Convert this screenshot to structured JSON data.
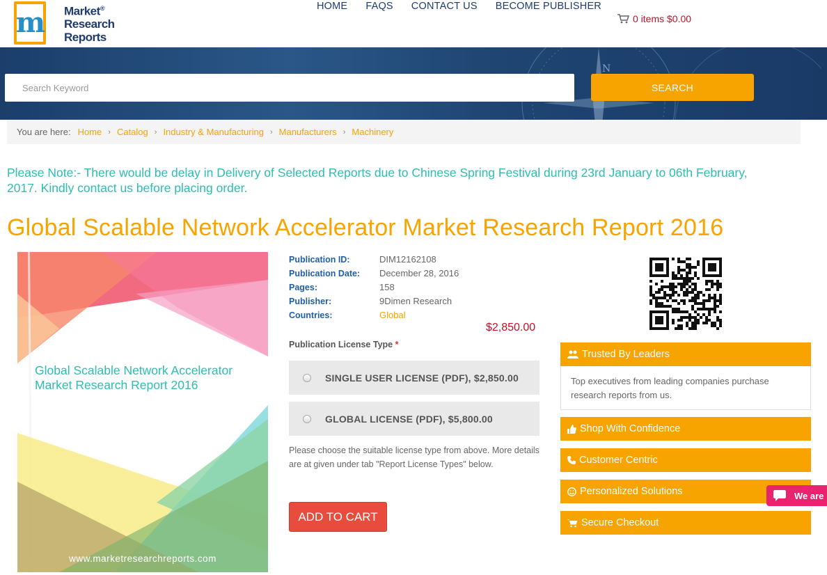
{
  "logo": {
    "line1": "Market",
    "line2": "Research",
    "line3": "Reports",
    "mark": "m",
    "reg": "®"
  },
  "nav": [
    "HOME",
    "FAQS",
    "CONTACT US",
    "BECOME PUBLISHER"
  ],
  "cart": {
    "label": "0 items $0.00",
    "icon": "cart-icon"
  },
  "search": {
    "placeholder": "Search Keyword",
    "button": "SEARCH"
  },
  "breadcrumb": {
    "lead": "You are here:",
    "items": [
      "Home",
      "Catalog",
      "Industry & Manufacturing",
      "Manufacturers",
      "Machinery"
    ]
  },
  "note": "Please Note:- There would be delay in Delivery of Selected Reports due to Chinese Spring Festival during 23rd January to 06th February, 2017. Kindly contact us before placing order.",
  "title": "Global Scalable Network Accelerator Market Research Report 2016",
  "cover": {
    "title": "Global Scalable Network Accelerator Market Research Report 2016",
    "url": "www.marketresearchreports.com"
  },
  "details": [
    {
      "key": "Publication ID:",
      "value": "DIM12162108"
    },
    {
      "key": "Publication Date:",
      "value": "December 28, 2016"
    },
    {
      "key": "Pages:",
      "value": "158"
    },
    {
      "key": "Publisher:",
      "value": "9Dimen Research"
    },
    {
      "key": "Countries:",
      "value": "Global"
    }
  ],
  "price": "$2,850.00",
  "license": {
    "label": "Publication License Type",
    "required": "*",
    "options": [
      "SINGLE USER LICENSE (PDF), $2,850.00",
      "GLOBAL LICENSE (PDF), $5,800.00"
    ],
    "help": "Please choose the suitable license type from above. More details are at given under tab \"Report License Types\" below."
  },
  "add_to_cart": "ADD TO CART",
  "panels": {
    "trusted": {
      "title": "Trusted By Leaders",
      "body": "Top executives from leading companies purchase research reports from us.",
      "icon": "users-icon"
    },
    "shop": {
      "title": "Shop With Confidence",
      "icon": "thumbs-up-icon"
    },
    "customer": {
      "title": "Customer Centric",
      "icon": "phone-icon"
    },
    "personal": {
      "title": "Personalized Solutions",
      "icon": "smile-icon"
    },
    "secure": {
      "title": "Secure Checkout",
      "icon": "cart-icon"
    }
  },
  "chat": {
    "label": "We are"
  },
  "colors": {
    "accent": "#f7a400",
    "teal": "#2ebdb1",
    "navy": "#1f3b6e",
    "price": "#c4102a",
    "cta": "#e84c3d"
  }
}
